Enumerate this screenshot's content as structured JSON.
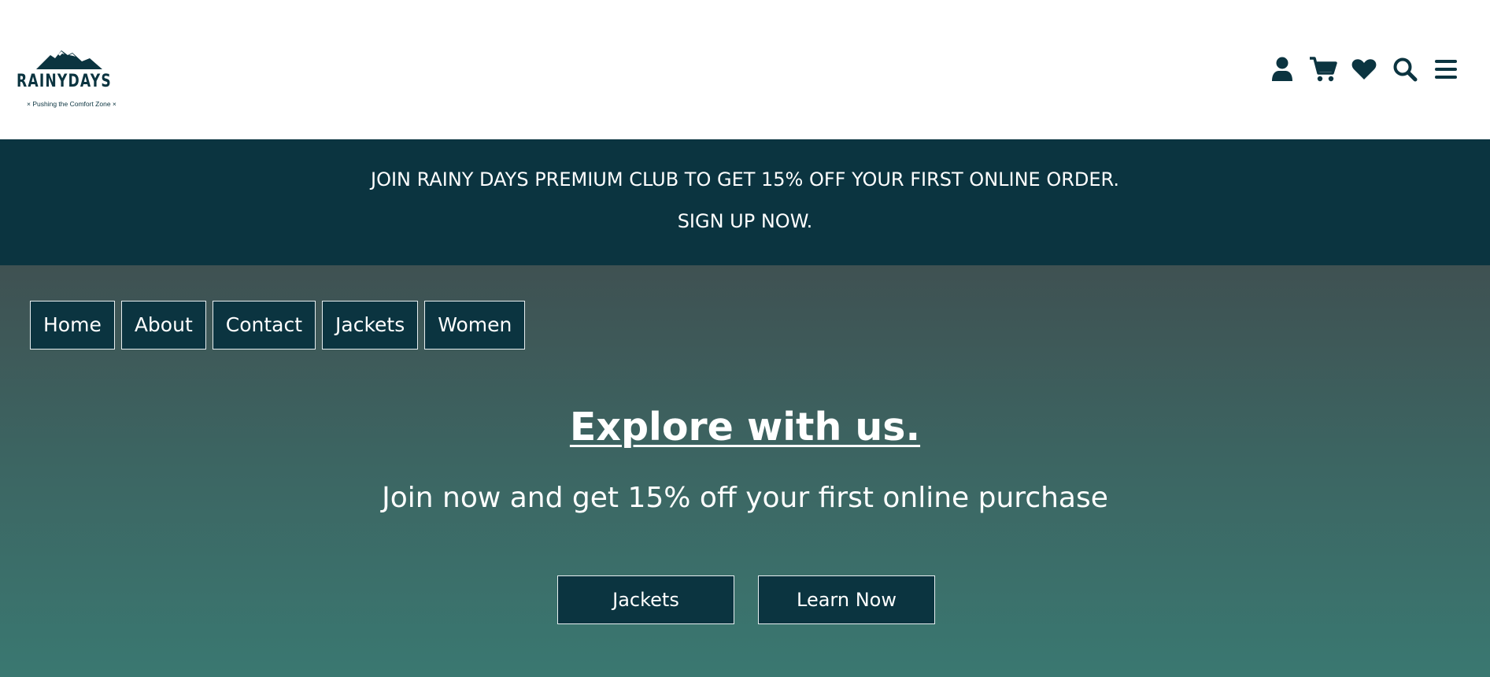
{
  "brand": {
    "name": "RAINYDAYS",
    "tagline": "× Pushing the Comfort Zone ×",
    "color": "#0b3440"
  },
  "header": {
    "icons": [
      {
        "name": "user-icon"
      },
      {
        "name": "cart-icon"
      },
      {
        "name": "heart-icon"
      },
      {
        "name": "search-icon"
      },
      {
        "name": "menu-icon"
      }
    ]
  },
  "banner": {
    "line1": "JOIN RAINY DAYS PREMIUM CLUB TO GET 15% OFF YOUR FIRST ONLINE ORDER.",
    "line2": "SIGN UP NOW."
  },
  "nav": {
    "items": [
      "Home",
      "About",
      "Contact",
      "Jackets",
      "Women"
    ]
  },
  "hero": {
    "title": "Explore with us.",
    "subtitle": "Join now and get 15% off your first online purchase",
    "buttons": [
      "Jackets",
      "Learn Now"
    ]
  },
  "colors": {
    "primary": "#0b3440",
    "hero_top": "#3f5152",
    "hero_bottom": "#3a7871",
    "text_light": "#ffffff"
  }
}
